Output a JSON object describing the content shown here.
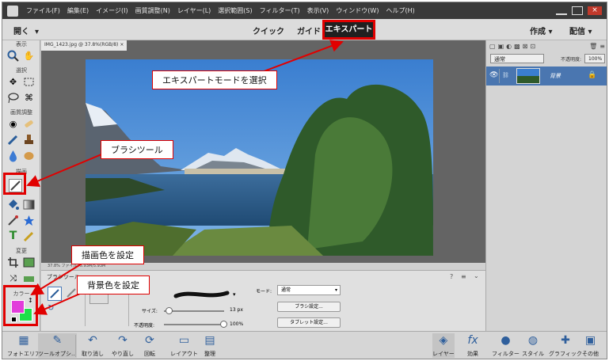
{
  "menubar": {
    "items": [
      "ファイル(F)",
      "編集(E)",
      "イメージ(I)",
      "画質調整(N)",
      "レイヤー(L)",
      "選択範囲(S)",
      "フィルター(T)",
      "表示(V)",
      "ウィンドウ(W)",
      "ヘルプ(H)"
    ],
    "close": "×"
  },
  "modebar": {
    "open": "開く",
    "open_arrow": "▾",
    "quick": "クイック",
    "guide": "ガイド",
    "expert": "エキスパート",
    "create": "作成",
    "create_arrow": "▾",
    "share": "配信",
    "share_arrow": "▾"
  },
  "toolbox": {
    "view": "表示",
    "select": "選択",
    "enhance": "画質調整",
    "draw": "描画",
    "modify": "変更",
    "color": "カラー"
  },
  "document": {
    "tab": "IMG_1423.jpg @ 37.8%(RGB/8)",
    "tab_close": "×",
    "status": "37.8%   ファイル: 5.93M/5.93M"
  },
  "options": {
    "tool_name": "ブラシツール",
    "mode_label": "モード:",
    "mode_value": "通常",
    "size_label": "サイズ:",
    "size_value": "13 px",
    "opacity_label": "不透明度:",
    "opacity_value": "100%",
    "brush_settings": "ブラシ設定...",
    "tablet_settings": "タブレット設定..."
  },
  "layers": {
    "blend_mode": "通常",
    "opacity_label": "不透明度:",
    "opacity_value": "100%",
    "layer_name": "背景"
  },
  "taskbar": {
    "photo_bin": "フォトエリア",
    "tool_options": "ツールオプシ...",
    "undo": "取り消し",
    "redo": "やり直し",
    "rotate": "回転",
    "layout": "レイアウト",
    "organizer": "整理",
    "layers": "レイヤー",
    "effects": "効果",
    "filters": "フィルター",
    "styles": "スタイル",
    "graphics": "グラフィック",
    "more": "その他"
  },
  "callouts": {
    "expert_mode": "エキスパートモードを選択",
    "brush_tool": "ブラシツール",
    "foreground_color": "描画色を設定",
    "background_color": "背景色を設定"
  },
  "colors": {
    "foreground": "#e23ddb",
    "background": "#1ee04a",
    "highlight": "#e10000"
  }
}
